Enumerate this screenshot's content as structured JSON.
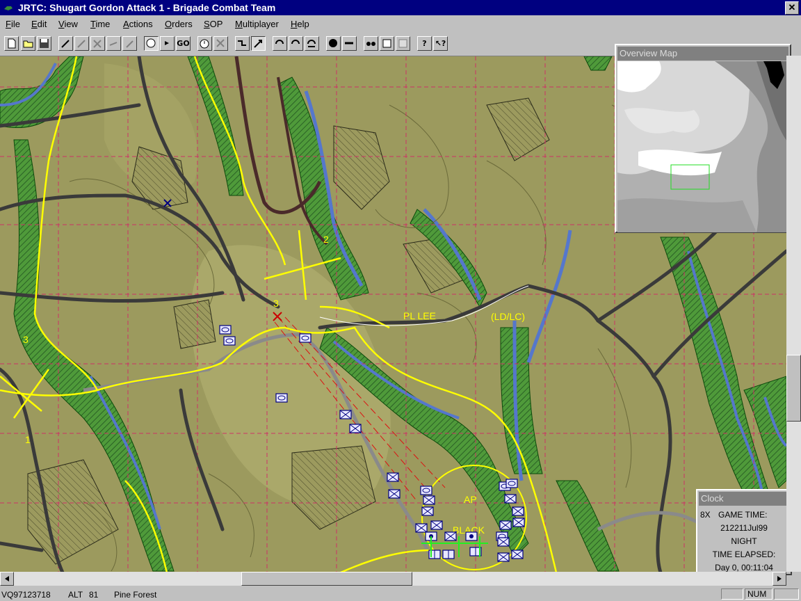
{
  "window": {
    "title": "JRTC: Shugart Gordon Attack 1 - Brigade Combat Team",
    "close_glyph": "✕"
  },
  "menu": [
    "File",
    "Edit",
    "View",
    "Time",
    "Actions",
    "Orders",
    "SOP",
    "Multiplayer",
    "Help"
  ],
  "toolbar": {
    "go_label": "GO",
    "help_glyph": "?",
    "context_help_glyph": "↖?"
  },
  "map": {
    "labels": {
      "pl_lee": "PL LEE",
      "ld_lc": "(LD/LC)",
      "ap": "AP",
      "black": "BLACK",
      "num_2": "2",
      "num_3a": "3",
      "num_3b": "3",
      "num_1": "1"
    },
    "colors": {
      "terrain": "#9c9a5e",
      "forest": "#2e8b2e",
      "river": "#5577cc",
      "road": "#3a3a3a",
      "yellow_line": "#ffff00",
      "grid": "#cc3366"
    }
  },
  "overview": {
    "title": "Overview Map"
  },
  "clock": {
    "title": "Clock",
    "speed": "8X",
    "game_time_label": "GAME TIME:",
    "game_time": "212211Jul99",
    "period": "NIGHT",
    "elapsed_label": "TIME ELAPSED:",
    "elapsed": "Day 0, 00:11:04"
  },
  "status": {
    "grid_ref": "VQ97123718",
    "alt_label": "ALT",
    "alt_value": "81",
    "terrain": "Pine Forest",
    "num": "NUM"
  }
}
